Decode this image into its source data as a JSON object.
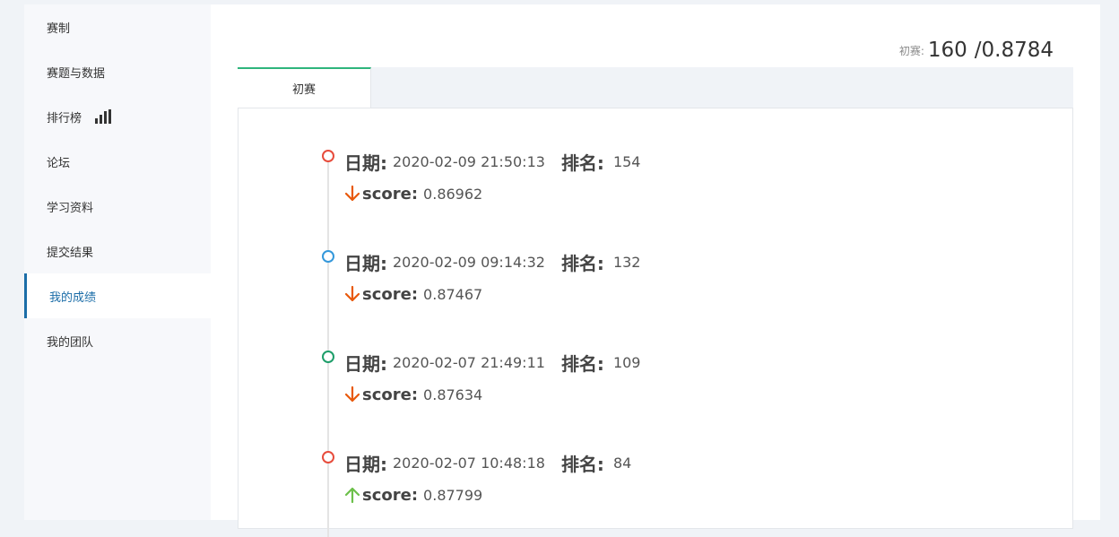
{
  "sidebar": {
    "items": [
      {
        "label": "赛制"
      },
      {
        "label": "赛题与数据"
      },
      {
        "label": "排行榜",
        "icon": "bar-chart-icon"
      },
      {
        "label": "论坛"
      },
      {
        "label": "学习资料"
      },
      {
        "label": "提交结果"
      },
      {
        "label": "我的成绩",
        "active": true
      },
      {
        "label": "我的团队"
      }
    ]
  },
  "summary": {
    "label": "初赛:",
    "rank": "160",
    "separator": "/",
    "score": "0.8784"
  },
  "tabs": [
    {
      "label": "初赛",
      "active": true
    }
  ],
  "labels": {
    "date": "日期:",
    "rank": "排名:",
    "score": "score:"
  },
  "entries": [
    {
      "date": "2020-02-09 21:50:13",
      "rank": "154",
      "score": "0.86962",
      "trend": "down",
      "dot_color": "red"
    },
    {
      "date": "2020-02-09 09:14:32",
      "rank": "132",
      "score": "0.87467",
      "trend": "down",
      "dot_color": "blue"
    },
    {
      "date": "2020-02-07 21:49:11",
      "rank": "109",
      "score": "0.87634",
      "trend": "down",
      "dot_color": "green"
    },
    {
      "date": "2020-02-07 10:48:18",
      "rank": "84",
      "score": "0.87799",
      "trend": "up",
      "dot_color": "red"
    }
  ],
  "colors": {
    "accent": "#1b6da8",
    "tab_accent": "#2fb57c",
    "down_arrow": "#e8590c",
    "up_arrow": "#6cc04a",
    "dot_red": "#e74c3c",
    "dot_blue": "#3498db",
    "dot_green": "#1e9e6a"
  }
}
